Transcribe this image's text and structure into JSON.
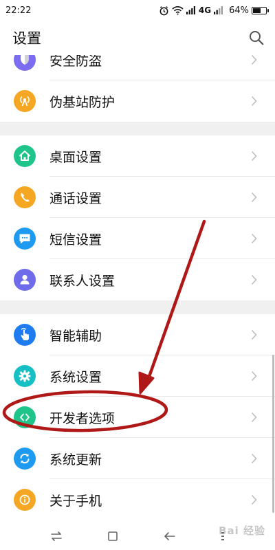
{
  "status_bar": {
    "time": "22:22",
    "network": "4G",
    "battery": "64%",
    "battery_level": 0.64
  },
  "header": {
    "title": "设置",
    "search_icon": "search-icon"
  },
  "list": {
    "groups": [
      [
        {
          "label": "安全防盗",
          "icon": "shield-icon",
          "color": "#7B6CF0"
        },
        {
          "label": "伪基站防护",
          "icon": "antenna-icon",
          "color": "#F5A623"
        }
      ],
      [
        {
          "label": "桌面设置",
          "icon": "home-icon",
          "color": "#1FC48A"
        },
        {
          "label": "通话设置",
          "icon": "phone-icon",
          "color": "#F5A623"
        },
        {
          "label": "短信设置",
          "icon": "message-icon",
          "color": "#1E9BF0"
        },
        {
          "label": "联系人设置",
          "icon": "contact-icon",
          "color": "#6E6CEB"
        }
      ],
      [
        {
          "label": "智能辅助",
          "icon": "touch-icon",
          "color": "#1E7CF0"
        },
        {
          "label": "系统设置",
          "icon": "gear-icon",
          "color": "#16BFC4"
        },
        {
          "label": "开发者选项",
          "icon": "code-icon",
          "color": "#1FC48A"
        },
        {
          "label": "系统更新",
          "icon": "refresh-icon",
          "color": "#1E9BF0"
        },
        {
          "label": "关于手机",
          "icon": "info-icon",
          "color": "#F5A623"
        }
      ]
    ]
  },
  "annotation": {
    "color": "#B01818"
  },
  "watermark": "Bai 经验"
}
